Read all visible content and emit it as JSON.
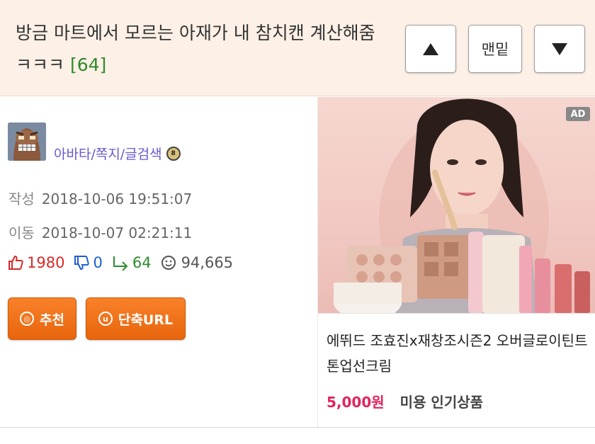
{
  "post": {
    "title": "방금 마트에서 모르는 아재가 내 참치캔 계산해줌ㅋㅋㅋ",
    "reply_count": "[64]"
  },
  "nav": {
    "bottom_label": "맨밑"
  },
  "author": {
    "links": "아바타/쪽지/글검색"
  },
  "meta": {
    "written_label": "작성",
    "written_date": "2018-10-06 19:51:07",
    "moved_label": "이동",
    "moved_date": "2018-10-07 02:21:11"
  },
  "stats": {
    "upvotes": "1980",
    "downvotes": "0",
    "replies": "64",
    "views": "94,665"
  },
  "actions": {
    "recommend_label": "추천",
    "shorturl_label": "단축URL"
  },
  "ad": {
    "badge": "AD",
    "title": "에뛰드 조효진x재창조시즌2 오버글로이틴트 톤업선크림",
    "price": "5,000원",
    "category": "미용 인기상품"
  },
  "colors": {
    "title_bg": "#fdf0e6",
    "accent_orange": "#f07318",
    "upvote_red": "#d62a2a",
    "downvote_blue": "#1e5fd0",
    "reply_green": "#2e8b2e",
    "price_pink": "#e0245e",
    "link_purple": "#6a5acd"
  }
}
